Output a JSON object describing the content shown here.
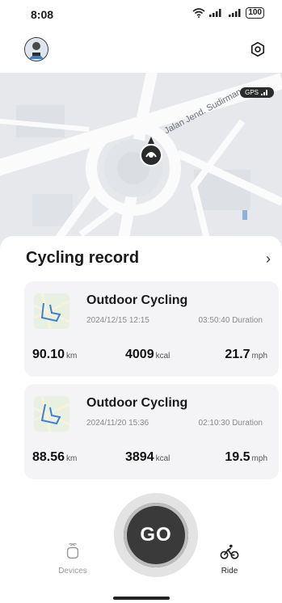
{
  "status_bar": {
    "time": "8:08",
    "battery": "100"
  },
  "map": {
    "street_label": "Jalan Jend. Sudirman",
    "gps_label": "GPS"
  },
  "records": {
    "title": "Cycling record",
    "items": [
      {
        "title": "Outdoor Cycling",
        "date": "2024/12/15 12:15",
        "duration": "03:50:40 Duration",
        "distance": "90.10",
        "distance_unit": "km",
        "calories": "4009",
        "calories_unit": "kcal",
        "speed": "21.7",
        "speed_unit": "mph"
      },
      {
        "title": "Outdoor Cycling",
        "date": "2024/11/20 15:36",
        "duration": "02:10:30 Duration",
        "distance": "88.56",
        "distance_unit": "km",
        "calories": "3894",
        "calories_unit": "kcal",
        "speed": "19.5",
        "speed_unit": "mph"
      }
    ]
  },
  "go_button": {
    "label": "GO"
  },
  "nav": {
    "devices_label": "Devices",
    "ride_label": "Ride"
  },
  "colors": {
    "card_bg": "#f4f4f6",
    "go_bg": "#3a3a3a",
    "map_bg": "#e6e8ec"
  },
  "icons": {
    "settings": "gear-icon",
    "wifi": "wifi-icon",
    "signal": "signal-icon",
    "devices": "watch-icon",
    "ride": "bicycle-icon"
  }
}
